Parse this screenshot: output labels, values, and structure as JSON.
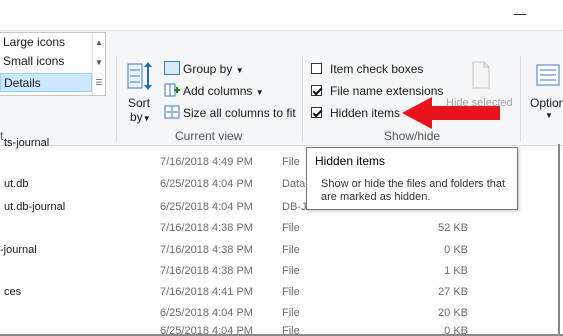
{
  "ribbon": {
    "layout": {
      "items": [
        "Large icons",
        "Small icons",
        "Details"
      ],
      "selected": "Details",
      "group_label_fragment": "t"
    },
    "current_view": {
      "sort_by_line1": "Sort",
      "sort_by_line2": "by",
      "group_by": "Group by",
      "add_columns": "Add columns",
      "size_all_columns": "Size all columns to fit",
      "group_label": "Current view"
    },
    "show_hide": {
      "item_check_boxes": {
        "label": "Item check boxes",
        "checked": false
      },
      "file_name_extensions": {
        "label": "File name extensions",
        "checked": true
      },
      "hidden_items": {
        "label": "Hidden items",
        "checked": true
      },
      "hide_selected": "Hide selected",
      "group_label": "Show/hide"
    },
    "options": "Option"
  },
  "files": [
    {
      "name": "ts-journal",
      "date": "",
      "type": "",
      "size": ""
    },
    {
      "name": "",
      "date": "7/16/2018 4:49 PM",
      "type": "File",
      "size": ""
    },
    {
      "name": "ut.db",
      "date": "6/25/2018 4:04 PM",
      "type": "Data",
      "size": ""
    },
    {
      "name": "ut.db-journal",
      "date": "6/25/2018 4:04 PM",
      "type": "DB-JOURNAL File",
      "size": ""
    },
    {
      "name": "",
      "date": "7/16/2018 4:38 PM",
      "type": "File",
      "size": "52 KB"
    },
    {
      "name": "-journal",
      "date": "7/16/2018 4:38 PM",
      "type": "File",
      "size": "0 KB"
    },
    {
      "name": "",
      "date": "7/16/2018 4:38 PM",
      "type": "File",
      "size": "1 KB"
    },
    {
      "name": "ces",
      "date": "7/16/2018 4:41 PM",
      "type": "File",
      "size": "27 KB"
    },
    {
      "name": "",
      "date": "6/25/2018 4:04 PM",
      "type": "File",
      "size": "20 KB"
    },
    {
      "name": "",
      "date": "6/25/2018 4:04 PM",
      "type": "File",
      "size": "0 KB"
    }
  ],
  "tooltip": {
    "title": "Hidden items",
    "description": "Show or hide the files and folders that are marked as hidden."
  },
  "colors": {
    "arrow": "#e8141c",
    "selection": "#cce8ff",
    "accent": "#0063b1"
  }
}
